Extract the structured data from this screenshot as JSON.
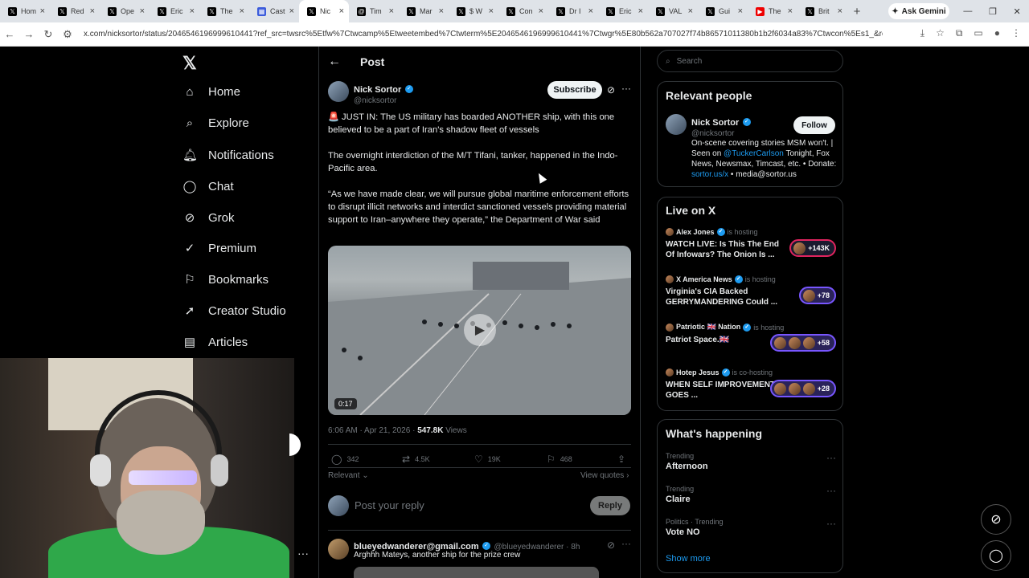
{
  "browser": {
    "tabs": [
      {
        "label": "Hom",
        "icon": "x-icon"
      },
      {
        "label": "Red",
        "icon": "x-icon"
      },
      {
        "label": "Ope",
        "icon": "x-icon"
      },
      {
        "label": "Eric",
        "icon": "x-icon"
      },
      {
        "label": "The",
        "icon": "x-icon"
      },
      {
        "label": "Cast",
        "icon": "site-icon"
      },
      {
        "label": "Nic",
        "icon": "x-icon",
        "active": true
      },
      {
        "label": "Tim",
        "icon": "threads-icon"
      },
      {
        "label": "Mar",
        "icon": "x-icon"
      },
      {
        "label": "$ W",
        "icon": "x-icon"
      },
      {
        "label": "Con",
        "icon": "x-icon"
      },
      {
        "label": "Dr I",
        "icon": "x-icon"
      },
      {
        "label": "Eric",
        "icon": "x-icon"
      },
      {
        "label": "VAL",
        "icon": "x-icon"
      },
      {
        "label": "Gui",
        "icon": "x-icon"
      },
      {
        "label": "The",
        "icon": "youtube-icon"
      },
      {
        "label": "Brit",
        "icon": "x-icon"
      }
    ],
    "ask_gemini": "Ask Gemini",
    "url": "x.com/nicksortor/status/2046546196999610441?ref_src=twsrc%5Etfw%7Ctwcamp%5Etweetembed%7Ctwterm%5E2046546196999610441%7Ctwgr%5E80b562a707027f74b86571011380b1b2f6034a83%7Ctwcon%5Es1_&ref_url=http%3A%2F..."
  },
  "nav": {
    "items": [
      "Home",
      "Explore",
      "Notifications",
      "Chat",
      "Grok",
      "Premium",
      "Bookmarks",
      "Creator Studio",
      "Articles"
    ]
  },
  "post": {
    "header_title": "Post",
    "author_name": "Nick Sortor",
    "author_handle": "@nicksortor",
    "subscribe": "Subscribe",
    "para1": "🚨 JUST IN: The US military has boarded ANOTHER ship, with this one believed to be a part of Iran's shadow fleet of vessels",
    "para2": "The overnight interdiction of the M/T Tifani, tanker, happened in the Indo-Pacific area.",
    "para3": "“As we have made clear, we will pursue global maritime enforcement efforts to disrupt illicit networks and interdict sanctioned vessels providing material support to Iran–anywhere they operate,” the Department of War said",
    "video_time": "0:17",
    "timestamp": "6:06 AM · Apr 21, 2026 · ",
    "views_count": "547.8K",
    "views_label": " Views",
    "stats": {
      "replies": "342",
      "reposts": "4.5K",
      "likes": "19K",
      "bookmarks": "468"
    },
    "relevant": "Relevant",
    "view_quotes": "View quotes",
    "reply_placeholder": "Post your reply",
    "reply_button": "Reply"
  },
  "reply": {
    "name": "blueyedwanderer@gmail.com",
    "handle": "@blueyedwanderer · 8h",
    "text": "Arghhh Mateys, another ship for the prize crew"
  },
  "right": {
    "search_placeholder": "Search",
    "relevant_people_title": "Relevant people",
    "person_name": "Nick Sortor",
    "person_handle": "@nicksortor",
    "follow": "Follow",
    "bio_a": "On-scene covering stories MSM won't. | Seen on ",
    "bio_link1": "@TuckerCarlson",
    "bio_b": " Tonight, Fox News, Newsmax, Timcast, etc. • Donate: ",
    "bio_link2": "sortor.us/x",
    "bio_c": " • media@sortor.us",
    "live_title": "Live on X",
    "live": [
      {
        "host": "Alex Jones",
        "status": "is hosting",
        "title": "WATCH LIVE: Is This The End Of Infowars? The Onion Is ...",
        "count": "+143K"
      },
      {
        "host": "X America News",
        "status": "is hosting",
        "title": "Virginia's CIA Backed GERRYMANDERING Could ...",
        "count": "+78"
      },
      {
        "host": "Patriotic 🇬🇧 Nation",
        "status": "is hosting",
        "title": "Patriot Space.🇬🇧",
        "count": "+58"
      },
      {
        "host": "Hotep Jesus",
        "status": "is co-hosting",
        "title": "WHEN SELF IMPROVEMENT GOES ...",
        "count": "+28"
      }
    ],
    "happening_title": "What's happening",
    "trends": [
      {
        "cat": "Trending",
        "name": "Afternoon"
      },
      {
        "cat": "Trending",
        "name": "Claire"
      },
      {
        "cat": "Politics · Trending",
        "name": "Vote NO"
      }
    ],
    "show_more": "Show more"
  }
}
